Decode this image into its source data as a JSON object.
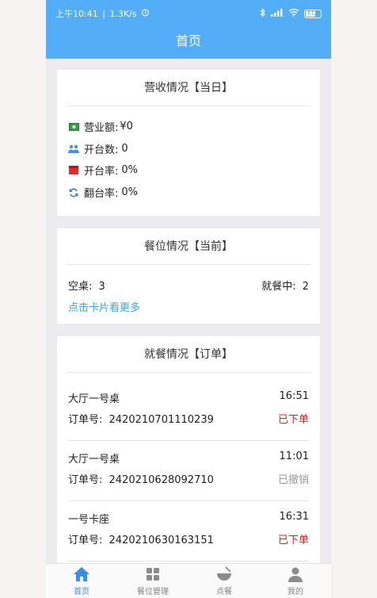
{
  "status_bar": {
    "time": "上午10:41",
    "speed": "1.3K/s",
    "battery": "61"
  },
  "header": {
    "title": "首页"
  },
  "revenue": {
    "title": "营收情况【当日】",
    "items": [
      {
        "label": "营业额:",
        "value": "¥0",
        "icon": "money-icon"
      },
      {
        "label": "开台数:",
        "value": "0",
        "icon": "people-icon"
      },
      {
        "label": "开台率:",
        "value": "0%",
        "icon": "table-icon"
      },
      {
        "label": "翻台率:",
        "value": "0%",
        "icon": "refresh-icon"
      }
    ]
  },
  "seats": {
    "title": "餐位情况【当前】",
    "empty_label": "空桌:",
    "empty_value": "3",
    "dining_label": "就餐中:",
    "dining_value": "2",
    "more_link": "点击卡片看更多"
  },
  "orders": {
    "title": "就餐情况【订单】",
    "order_no_label": "订单号:",
    "list": [
      {
        "table": "大厅一号桌",
        "time": "16:51",
        "order_no": "2420210701110239",
        "status": "已下单",
        "status_type": "red"
      },
      {
        "table": "大厅一号桌",
        "time": "11:01",
        "order_no": "2420210628092710",
        "status": "已撤销",
        "status_type": "gray"
      },
      {
        "table": "一号卡座",
        "time": "16:31",
        "order_no": "2420210630163151",
        "status": "已下单",
        "status_type": "red"
      }
    ]
  },
  "tabbar": {
    "items": [
      {
        "label": "首页",
        "icon": "home-icon",
        "active": true
      },
      {
        "label": "餐位管理",
        "icon": "grid-icon",
        "active": false
      },
      {
        "label": "点餐",
        "icon": "bowl-icon",
        "active": false
      },
      {
        "label": "我的",
        "icon": "user-icon",
        "active": false
      }
    ]
  },
  "colors": {
    "brand": "#54adf7",
    "link": "#3aa6e8",
    "status_red": "#e02020",
    "status_gray": "#9a9a9a",
    "tab_active": "#3a8ee6"
  }
}
